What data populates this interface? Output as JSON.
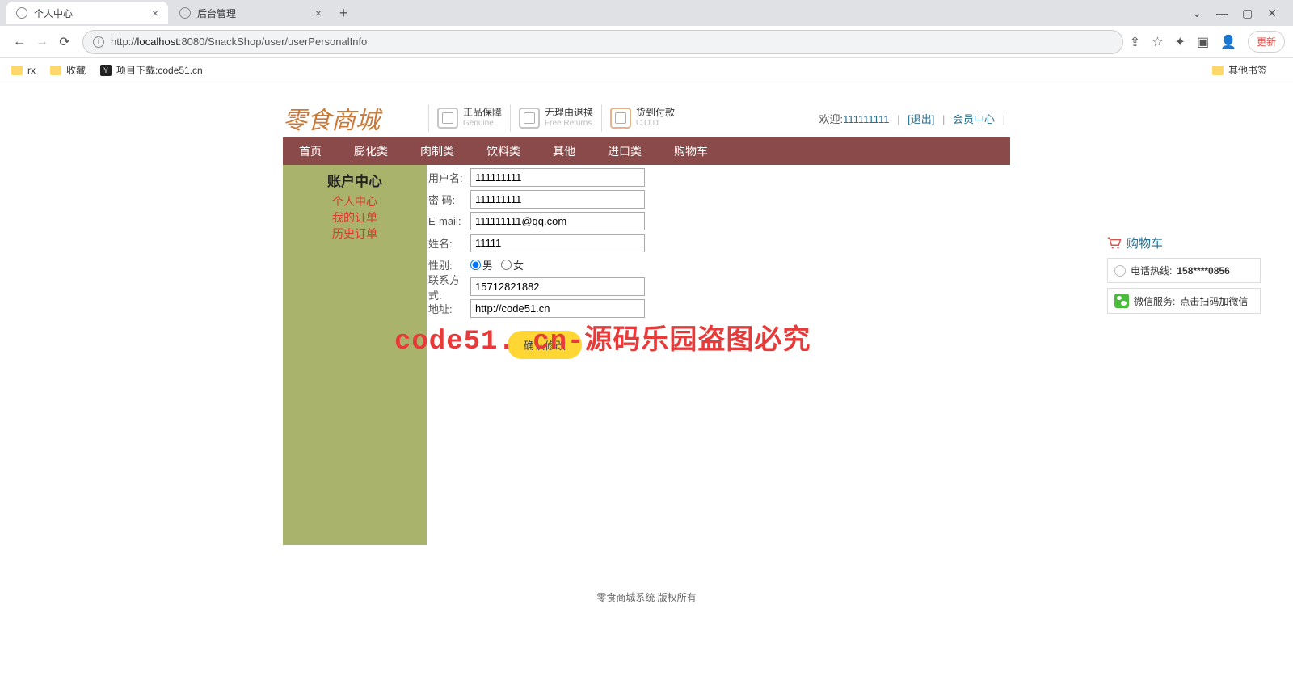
{
  "browser": {
    "tabs": [
      {
        "title": "个人中心"
      },
      {
        "title": "后台管理"
      }
    ],
    "url_host": "localhost",
    "url_port": ":8080",
    "url_path": "/SnackShop/user/userPersonalInfo",
    "url_prefix": "http://",
    "update_btn": "更新",
    "bookmarks": [
      {
        "label": "rx",
        "type": "folder"
      },
      {
        "label": "收藏",
        "type": "folder"
      },
      {
        "label": "项目下载:code51.cn",
        "type": "favicon"
      }
    ],
    "bm_other": "其他书签"
  },
  "header": {
    "logo": "零食商城",
    "badges": [
      {
        "title": "正品保障",
        "sub": "Genuine"
      },
      {
        "title": "无理由退换",
        "sub": "Free Returns"
      },
      {
        "title": "货到付款",
        "sub": "C.O.D"
      }
    ],
    "welcome_prefix": "欢迎:",
    "welcome_user": "111111111",
    "logout": "[退出]",
    "member_center": "会员中心"
  },
  "nav": [
    "首页",
    "膨化类",
    "肉制类",
    "饮料类",
    "其他",
    "进口类",
    "购物车"
  ],
  "sidebar": {
    "title": "账户中心",
    "links": [
      "个人中心",
      "我的订单",
      "历史订单"
    ]
  },
  "form": {
    "labels": {
      "username": "用户名:",
      "password": "密 码:",
      "email": "E-mail:",
      "realname": "姓名:",
      "gender": "性别:",
      "phone": "联系方式:",
      "address": "地址:"
    },
    "values": {
      "username": "111111111",
      "password": "111111111",
      "email": "111111111@qq.com",
      "realname": "11111",
      "phone": "15712821882",
      "address": "http://code51.cn"
    },
    "gender_options": {
      "male": "男",
      "female": "女"
    },
    "submit": "确认修改"
  },
  "footer": "零食商城系统 版权所有",
  "watermark": "code51. cn-源码乐园盗图必究",
  "float": {
    "title": "购物车",
    "hotline_label": "电话热线:",
    "hotline_value": "158****0856",
    "wechat_label": "微信服务:",
    "wechat_value": "点击扫码加微信"
  }
}
